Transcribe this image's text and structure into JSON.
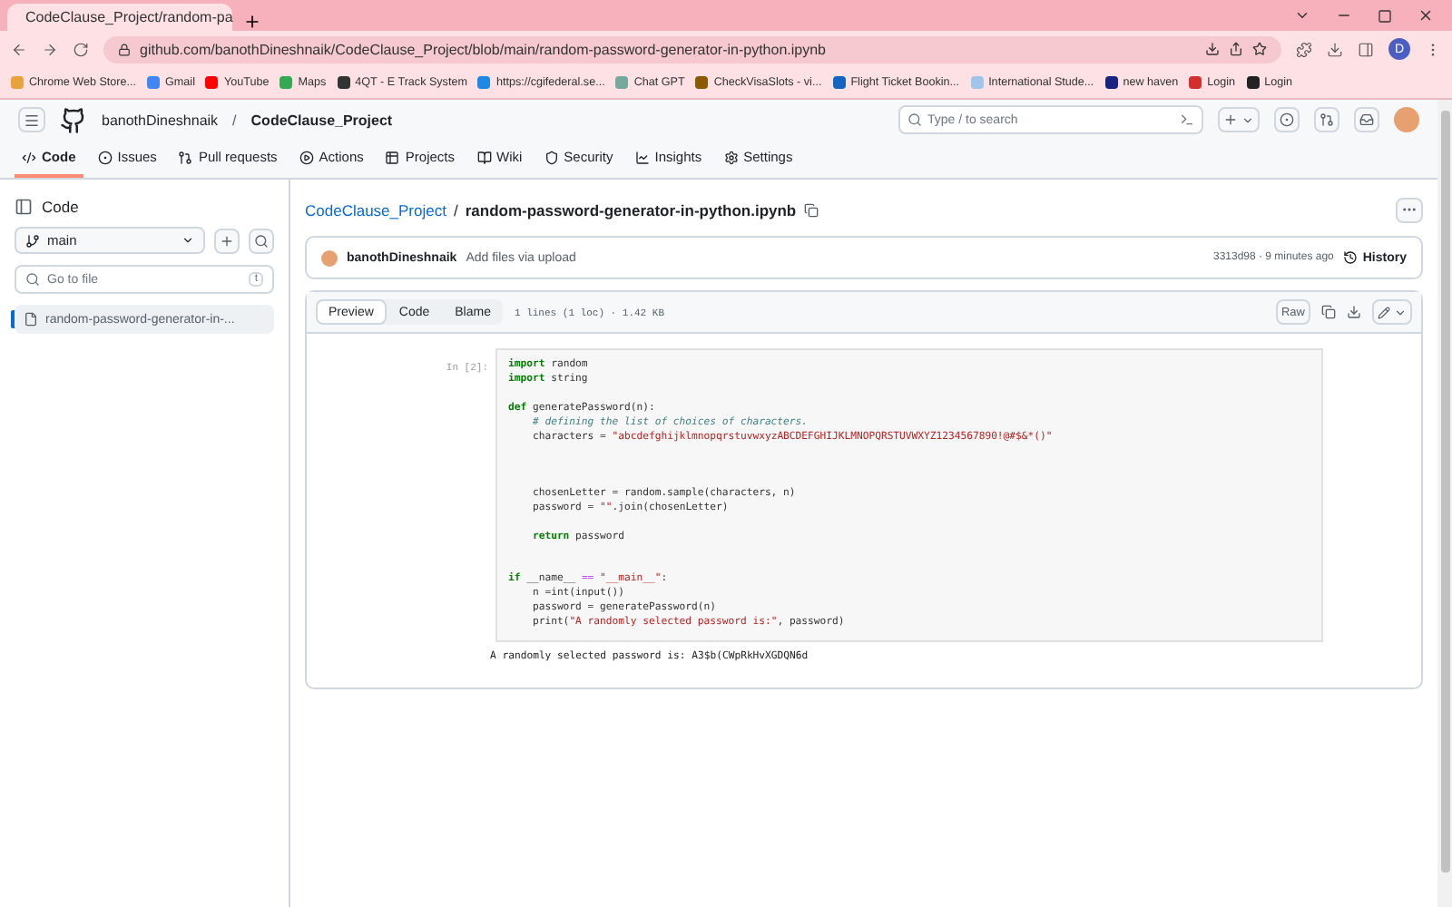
{
  "browser": {
    "tab_title": "CodeClause_Project/random-pa",
    "url": "github.com/banothDineshnaik/CodeClause_Project/blob/main/random-password-generator-in-python.ipynb",
    "profile_initial": "D",
    "bookmarks": [
      "Chrome Web Store...",
      "Gmail",
      "YouTube",
      "Maps",
      "4QT - E Track System",
      "https://cgifederal.se...",
      "Chat GPT",
      "CheckVisaSlots - vi...",
      "Flight Ticket Bookin...",
      "International Stude...",
      "new haven",
      "Login",
      "Login"
    ]
  },
  "header": {
    "owner": "banothDineshnaik",
    "separator": "/",
    "repo": "CodeClause_Project",
    "search_placeholder": "Type / to search"
  },
  "repo_nav": [
    {
      "label": "Code",
      "selected": true
    },
    {
      "label": "Issues",
      "selected": false
    },
    {
      "label": "Pull requests",
      "selected": false
    },
    {
      "label": "Actions",
      "selected": false
    },
    {
      "label": "Projects",
      "selected": false
    },
    {
      "label": "Wiki",
      "selected": false
    },
    {
      "label": "Security",
      "selected": false
    },
    {
      "label": "Insights",
      "selected": false
    },
    {
      "label": "Settings",
      "selected": false
    }
  ],
  "sidebar": {
    "title": "Code",
    "branch": "main",
    "filter_placeholder": "Go to file",
    "filter_shortcut": "t",
    "files": [
      {
        "name": "random-password-generator-in-...",
        "selected": true
      }
    ]
  },
  "file": {
    "repo_link": "CodeClause_Project",
    "separator": "/",
    "name": "random-password-generator-in-python.ipynb",
    "author": "banothDineshnaik",
    "commit_message": "Add files via upload",
    "commit_meta": "3313d98 · 9 minutes ago",
    "history": "History",
    "view_tabs": [
      {
        "label": "Preview",
        "selected": true
      },
      {
        "label": "Code",
        "selected": false
      },
      {
        "label": "Blame",
        "selected": false
      }
    ],
    "stats": "1 lines (1 loc) · 1.42 KB",
    "raw": "Raw"
  },
  "cell": {
    "prompt": "In [2]:",
    "lines": [
      {
        "kind": "code",
        "tokens": [
          {
            "text": "import",
            "kind": "keyword"
          },
          {
            "text": " random",
            "kind": "plain"
          }
        ]
      },
      {
        "kind": "code",
        "tokens": [
          {
            "text": "import",
            "kind": "keyword"
          },
          {
            "text": " string",
            "kind": "plain"
          }
        ]
      },
      {
        "kind": "blank"
      },
      {
        "kind": "code",
        "tokens": [
          {
            "text": "def",
            "kind": "keyword"
          },
          {
            "text": " generatePassword(n):",
            "kind": "plain"
          }
        ]
      },
      {
        "kind": "code",
        "tokens": [
          {
            "text": "    # defining the list of choices of characters.",
            "kind": "comment"
          }
        ]
      },
      {
        "kind": "code",
        "tokens": [
          {
            "text": "    characters = ",
            "kind": "plain"
          },
          {
            "text": "\"abcdefghijklmnopqrstuvwxyzABCDEFGHIJKLMNOPQRSTUVWXYZ1234567890!@#$&*()\"",
            "kind": "string"
          }
        ]
      },
      {
        "kind": "blank"
      },
      {
        "kind": "blank"
      },
      {
        "kind": "blank"
      },
      {
        "kind": "code",
        "tokens": [
          {
            "text": "    chosenLetter = random.sample(characters, n)",
            "kind": "plain"
          }
        ]
      },
      {
        "kind": "code",
        "tokens": [
          {
            "text": "    password = ",
            "kind": "plain"
          },
          {
            "text": "\"\"",
            "kind": "string"
          },
          {
            "text": ".join(chosenLetter)",
            "kind": "plain"
          }
        ]
      },
      {
        "kind": "blank"
      },
      {
        "kind": "code",
        "tokens": [
          {
            "text": "    return",
            "kind": "keyword"
          },
          {
            "text": " password",
            "kind": "plain"
          }
        ]
      },
      {
        "kind": "blank"
      },
      {
        "kind": "blank"
      },
      {
        "kind": "code",
        "tokens": [
          {
            "text": "if",
            "kind": "keyword"
          },
          {
            "text": " __name__ ",
            "kind": "plain"
          },
          {
            "text": "==",
            "kind": "operator"
          },
          {
            "text": " \"__main__\"",
            "kind": "string"
          },
          {
            "text": ":",
            "kind": "plain"
          }
        ]
      },
      {
        "kind": "code",
        "tokens": [
          {
            "text": "    n =int(input())",
            "kind": "plain"
          }
        ]
      },
      {
        "kind": "code",
        "tokens": [
          {
            "text": "    password = generatePassword(n)",
            "kind": "plain"
          }
        ]
      },
      {
        "kind": "code",
        "tokens": [
          {
            "text": "    print(",
            "kind": "plain"
          },
          {
            "text": "\"A randomly selected password is:\"",
            "kind": "string"
          },
          {
            "text": ", password)",
            "kind": "plain"
          }
        ]
      }
    ],
    "output": "A randomly selected password is: A3$b(CWpRkHvXGDQN6d"
  }
}
